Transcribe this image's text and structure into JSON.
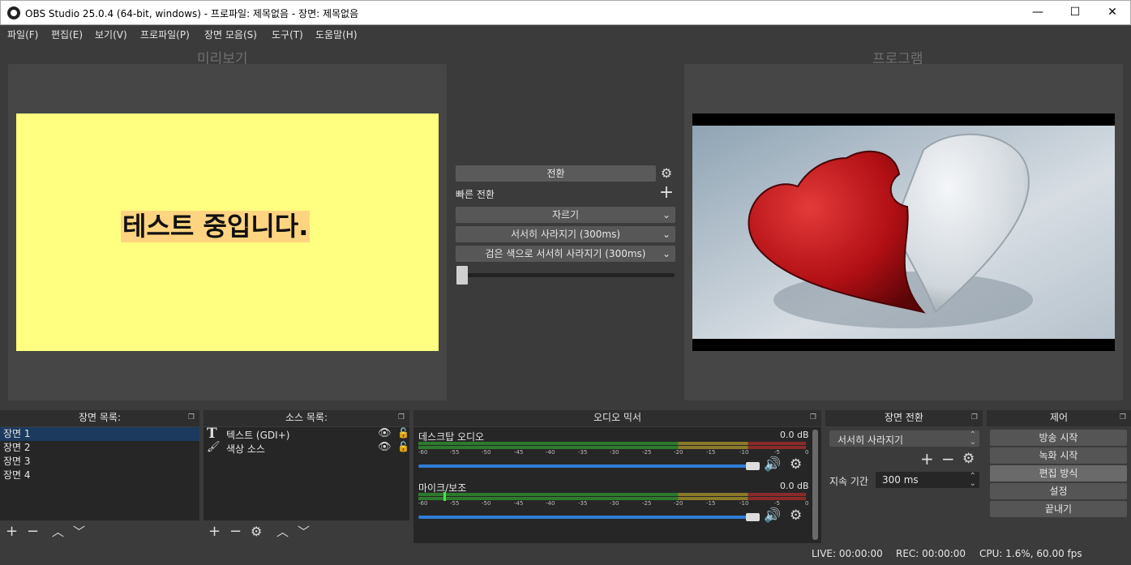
{
  "window": {
    "title": "OBS Studio 25.0.4 (64-bit, windows) - 프로파일: 제목없음 - 장면: 제목없음",
    "minimize": "—",
    "maximize": "☐",
    "close": "✕"
  },
  "menu": [
    "파일(F)",
    "편집(E)",
    "보기(V)",
    "프로파일(P)",
    "장면 모음(S)",
    "도구(T)",
    "도움말(H)"
  ],
  "preview": {
    "label": "미리보기",
    "text": "테스트 중입니다.",
    "bg_color": "#ffff80",
    "highlight_color": "#ffd480"
  },
  "program": {
    "label": "프로그램"
  },
  "transitions": {
    "transition_button": "전환",
    "quick_label": "빠른 전환",
    "quick_items": [
      "자르기",
      "서서히 사라지기 (300ms)",
      "검은 색으로 서서히 사라지기 (300ms)"
    ]
  },
  "docks": {
    "scenes": {
      "title": "장면 목록:",
      "items": [
        "장면 1",
        "장면 2",
        "장면 3",
        "장면 4"
      ],
      "selected_index": 0
    },
    "sources": {
      "title": "소스 목록:",
      "items": [
        {
          "label": "텍스트 (GDI+)",
          "icon": "text-T-icon"
        },
        {
          "label": "색상 소스",
          "icon": "brush-icon"
        }
      ]
    },
    "mixer": {
      "title": "오디오 믹서",
      "channels": [
        {
          "name": "데스크탑 오디오",
          "db": "0.0 dB"
        },
        {
          "name": "마이크/보조",
          "db": "0.0 dB"
        }
      ],
      "ticks": [
        "-60",
        "-55",
        "-50",
        "-45",
        "-40",
        "-35",
        "-30",
        "-25",
        "-20",
        "-15",
        "-10",
        "-5",
        "0"
      ]
    },
    "scene_transitions": {
      "title": "장면 전환",
      "selected": "서서히 사라지기",
      "duration_label": "지속 기간",
      "duration_value": "300 ms"
    },
    "controls": {
      "title": "제어",
      "buttons": [
        "방송 시작",
        "녹화 시작",
        "편집 방식",
        "설정",
        "끝내기"
      ],
      "active_index": 2
    }
  },
  "statusbar": {
    "live": "LIVE: 00:00:00",
    "rec": "REC: 00:00:00",
    "cpu": "CPU: 1.6%, 60.00 fps"
  }
}
